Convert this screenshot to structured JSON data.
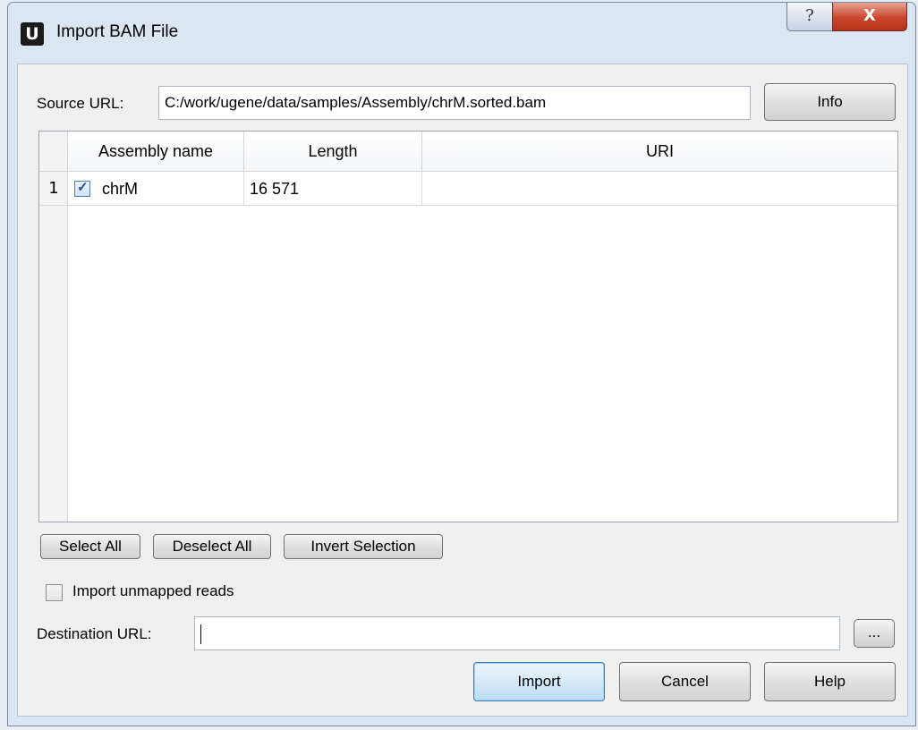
{
  "window": {
    "title": "Import BAM File",
    "app_icon_letter": "U",
    "help_glyph": "?",
    "close_glyph": "X"
  },
  "source": {
    "label": "Source URL:",
    "value": "C:/work/ugene/data/samples/Assembly/chrM.sorted.bam",
    "info_button": "Info"
  },
  "table": {
    "columns": [
      "Assembly name",
      "Length",
      "URI"
    ],
    "rows": [
      {
        "index": "1",
        "checked": true,
        "name": "chrM",
        "length": "16 571",
        "uri": ""
      }
    ]
  },
  "selection_buttons": {
    "select_all": "Select All",
    "deselect_all": "Deselect All",
    "invert_selection": "Invert Selection"
  },
  "import_unmapped": {
    "label": "Import unmapped reads",
    "checked": false
  },
  "destination": {
    "label": "Destination URL:",
    "value": "",
    "browse_button": "..."
  },
  "footer": {
    "import_button": "Import",
    "cancel_button": "Cancel",
    "help_button": "Help"
  },
  "colors": {
    "frame": "#dbe6f3",
    "close_button": "#c9452c",
    "default_button_border": "#3c7fb1",
    "checkbox_tick": "#1f4e9c"
  }
}
